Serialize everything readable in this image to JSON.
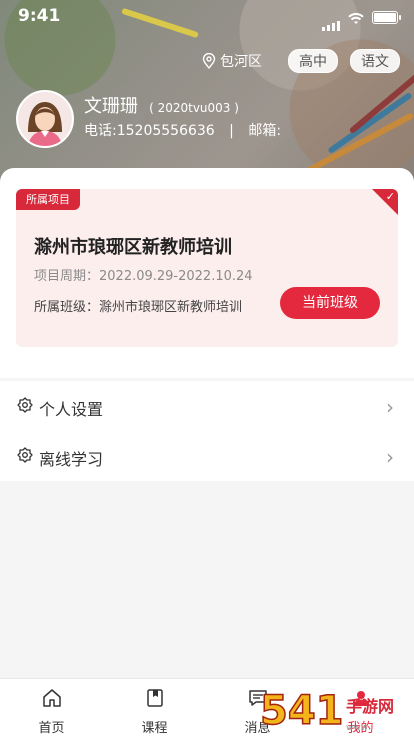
{
  "status_bar": {
    "time": "9:41"
  },
  "header": {
    "location": "包河区",
    "stage": "高中",
    "subject": "语文"
  },
  "profile": {
    "name": "文珊珊",
    "code": "( 2020tvu003 )",
    "phone": "电话:15205556636",
    "separator": "|",
    "email": "邮箱:"
  },
  "project_card": {
    "tag": "所属项目",
    "title": "滁州市琅琊区新教师培训",
    "period": "项目周期：2022.09.29-2022.10.24",
    "class_line": "所属班级：滁州市琅琊区新教师培训",
    "button_label": "当前班级"
  },
  "menu": {
    "items": [
      {
        "label": "个人设置",
        "icon": "gear-icon"
      },
      {
        "label": "离线学习",
        "icon": "gear-icon"
      }
    ]
  },
  "tabbar": {
    "items": [
      {
        "label": "首页",
        "icon": "home-icon"
      },
      {
        "label": "课程",
        "icon": "book-icon"
      },
      {
        "label": "消息",
        "icon": "message-icon"
      },
      {
        "label": "我的",
        "icon": "user-icon"
      }
    ]
  },
  "colors": {
    "accent": "#e4293f",
    "card_bg": "#fdeeee"
  }
}
